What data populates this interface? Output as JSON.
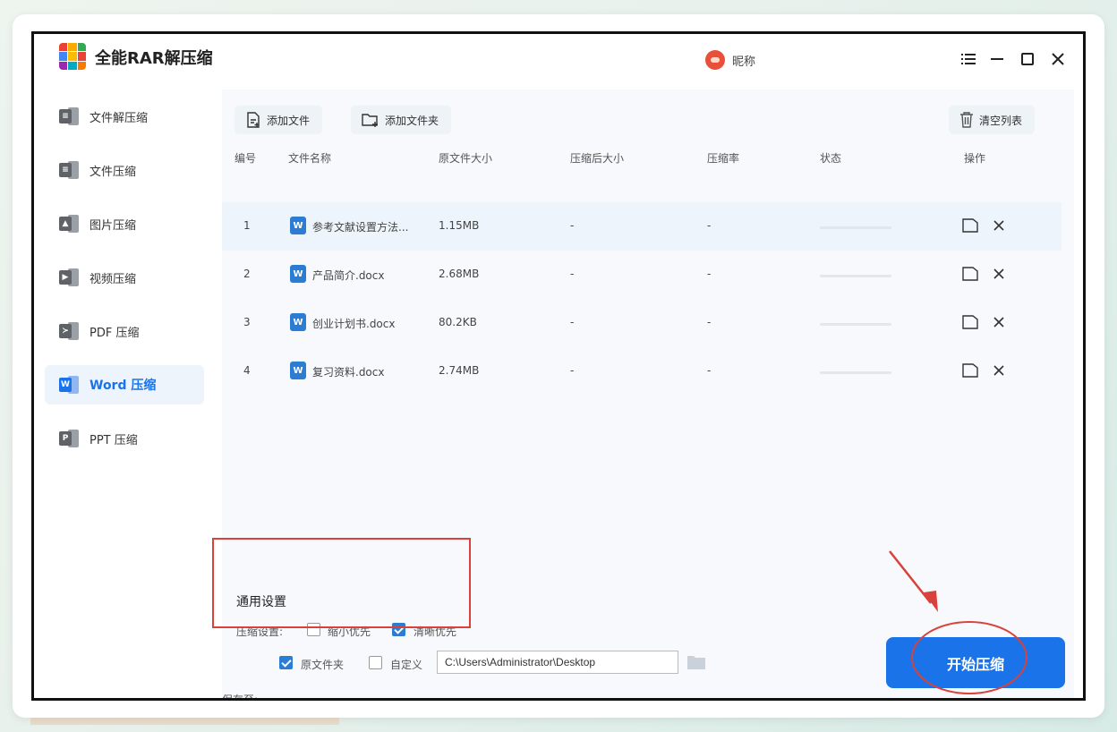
{
  "app": {
    "title": "全能RAR解压缩",
    "nickname": "昵称"
  },
  "sidebar": {
    "items": [
      {
        "label": "文件解压缩",
        "glyph": "≡"
      },
      {
        "label": "文件压缩",
        "glyph": "≡"
      },
      {
        "label": "图片压缩",
        "glyph": "▲"
      },
      {
        "label": "视频压缩",
        "glyph": "▶"
      },
      {
        "label": "PDF 压缩",
        "glyph": "≻"
      },
      {
        "label": "Word 压缩",
        "glyph": "W"
      },
      {
        "label": "PPT 压缩",
        "glyph": "P"
      }
    ],
    "active_index": 5
  },
  "toolbar": {
    "add_file": "添加文件",
    "add_folder": "添加文件夹",
    "clear_list": "清空列表"
  },
  "table": {
    "headers": {
      "index": "编号",
      "name": "文件名称",
      "orig_size": "原文件大小",
      "comp_size": "压缩后大小",
      "ratio": "压缩率",
      "status": "状态",
      "action": "操作"
    },
    "rows": [
      {
        "index": "1",
        "name": "参考文献设置方法...",
        "orig_size": "1.15MB",
        "comp_size": "-",
        "ratio": "-",
        "progress": 0
      },
      {
        "index": "2",
        "name": "产品简介.docx",
        "orig_size": "2.68MB",
        "comp_size": "-",
        "ratio": "-",
        "progress": 0
      },
      {
        "index": "3",
        "name": "创业计划书.docx",
        "orig_size": "80.2KB",
        "comp_size": "-",
        "ratio": "-",
        "progress": 0
      },
      {
        "index": "4",
        "name": "复习资料.docx",
        "orig_size": "2.74MB",
        "comp_size": "-",
        "ratio": "-",
        "progress": 0
      }
    ]
  },
  "settings": {
    "title": "通用设置",
    "label": "压缩设置:",
    "option_small": {
      "label": "缩小优先",
      "checked": false
    },
    "option_clear": {
      "label": "清晰优先",
      "checked": true
    }
  },
  "save": {
    "label": "保存至:",
    "original_folder": {
      "label": "原文件夹",
      "checked": true
    },
    "custom": {
      "label": "自定义",
      "checked": false
    },
    "path": "C:\\Users\\Administrator\\Desktop"
  },
  "start_button": "开始压缩",
  "colors": {
    "accent": "#1a73e8",
    "annotation": "#d9423a",
    "word": "#2b7cd3"
  }
}
